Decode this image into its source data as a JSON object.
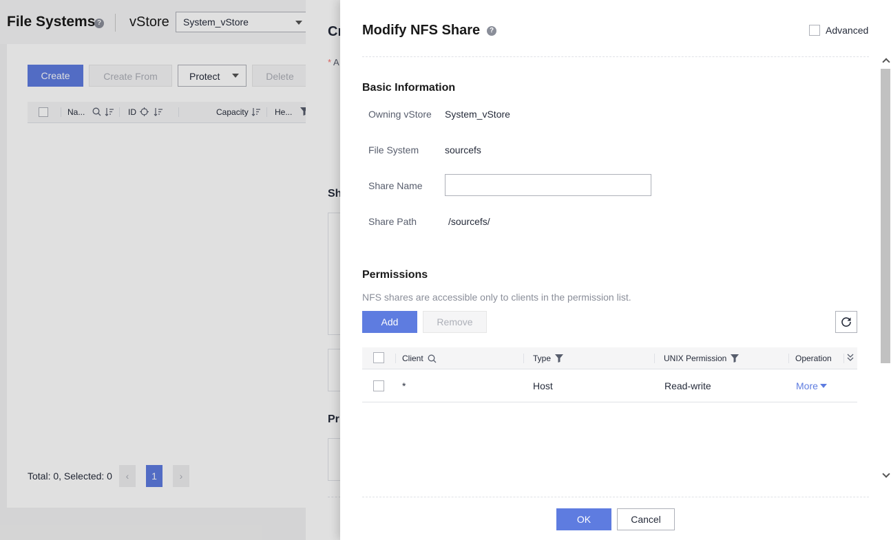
{
  "background": {
    "title": "File Systems",
    "help": "?",
    "vstore_label": "vStore",
    "vstore_value": "System_vStore",
    "toolbar": {
      "create": "Create",
      "create_from": "Create From",
      "protect": "Protect",
      "delete": "Delete"
    },
    "columns": [
      "Na...",
      "ID",
      "Capacity",
      "He..."
    ],
    "footer": {
      "total": "Total: 0, Selected: 0",
      "current_page": "1"
    }
  },
  "middle_panel": {
    "title_fragment": "Cr",
    "asterisk": "*",
    "asterisk_text": "A",
    "section1_fragment": "Sh",
    "section2_fragment": "Pr"
  },
  "drawer": {
    "title": "Modify NFS Share",
    "help": "?",
    "advanced_label": "Advanced",
    "basic": {
      "title": "Basic Information",
      "owning_vstore_label": "Owning vStore",
      "owning_vstore_value": "System_vStore",
      "file_system_label": "File System",
      "file_system_value": "sourcefs",
      "share_name_label": "Share Name",
      "share_name_value": "",
      "share_path_label": "Share Path",
      "share_path_value": "/sourcefs/"
    },
    "permissions": {
      "title": "Permissions",
      "hint": "NFS shares are accessible only to clients in the permission list.",
      "add": "Add",
      "remove": "Remove",
      "columns": {
        "client": "Client",
        "type": "Type",
        "unix_permission": "UNIX Permission",
        "operation": "Operation"
      },
      "rows": [
        {
          "client": "*",
          "type": "Host",
          "unix_permission": "Read-write",
          "operation": "More"
        }
      ]
    },
    "footer": {
      "ok": "OK",
      "cancel": "Cancel"
    }
  },
  "colors": {
    "primary": "#5e7ce0",
    "text": "#252b3a",
    "muted": "#8a8e99",
    "disabled": "#adb0b8"
  }
}
